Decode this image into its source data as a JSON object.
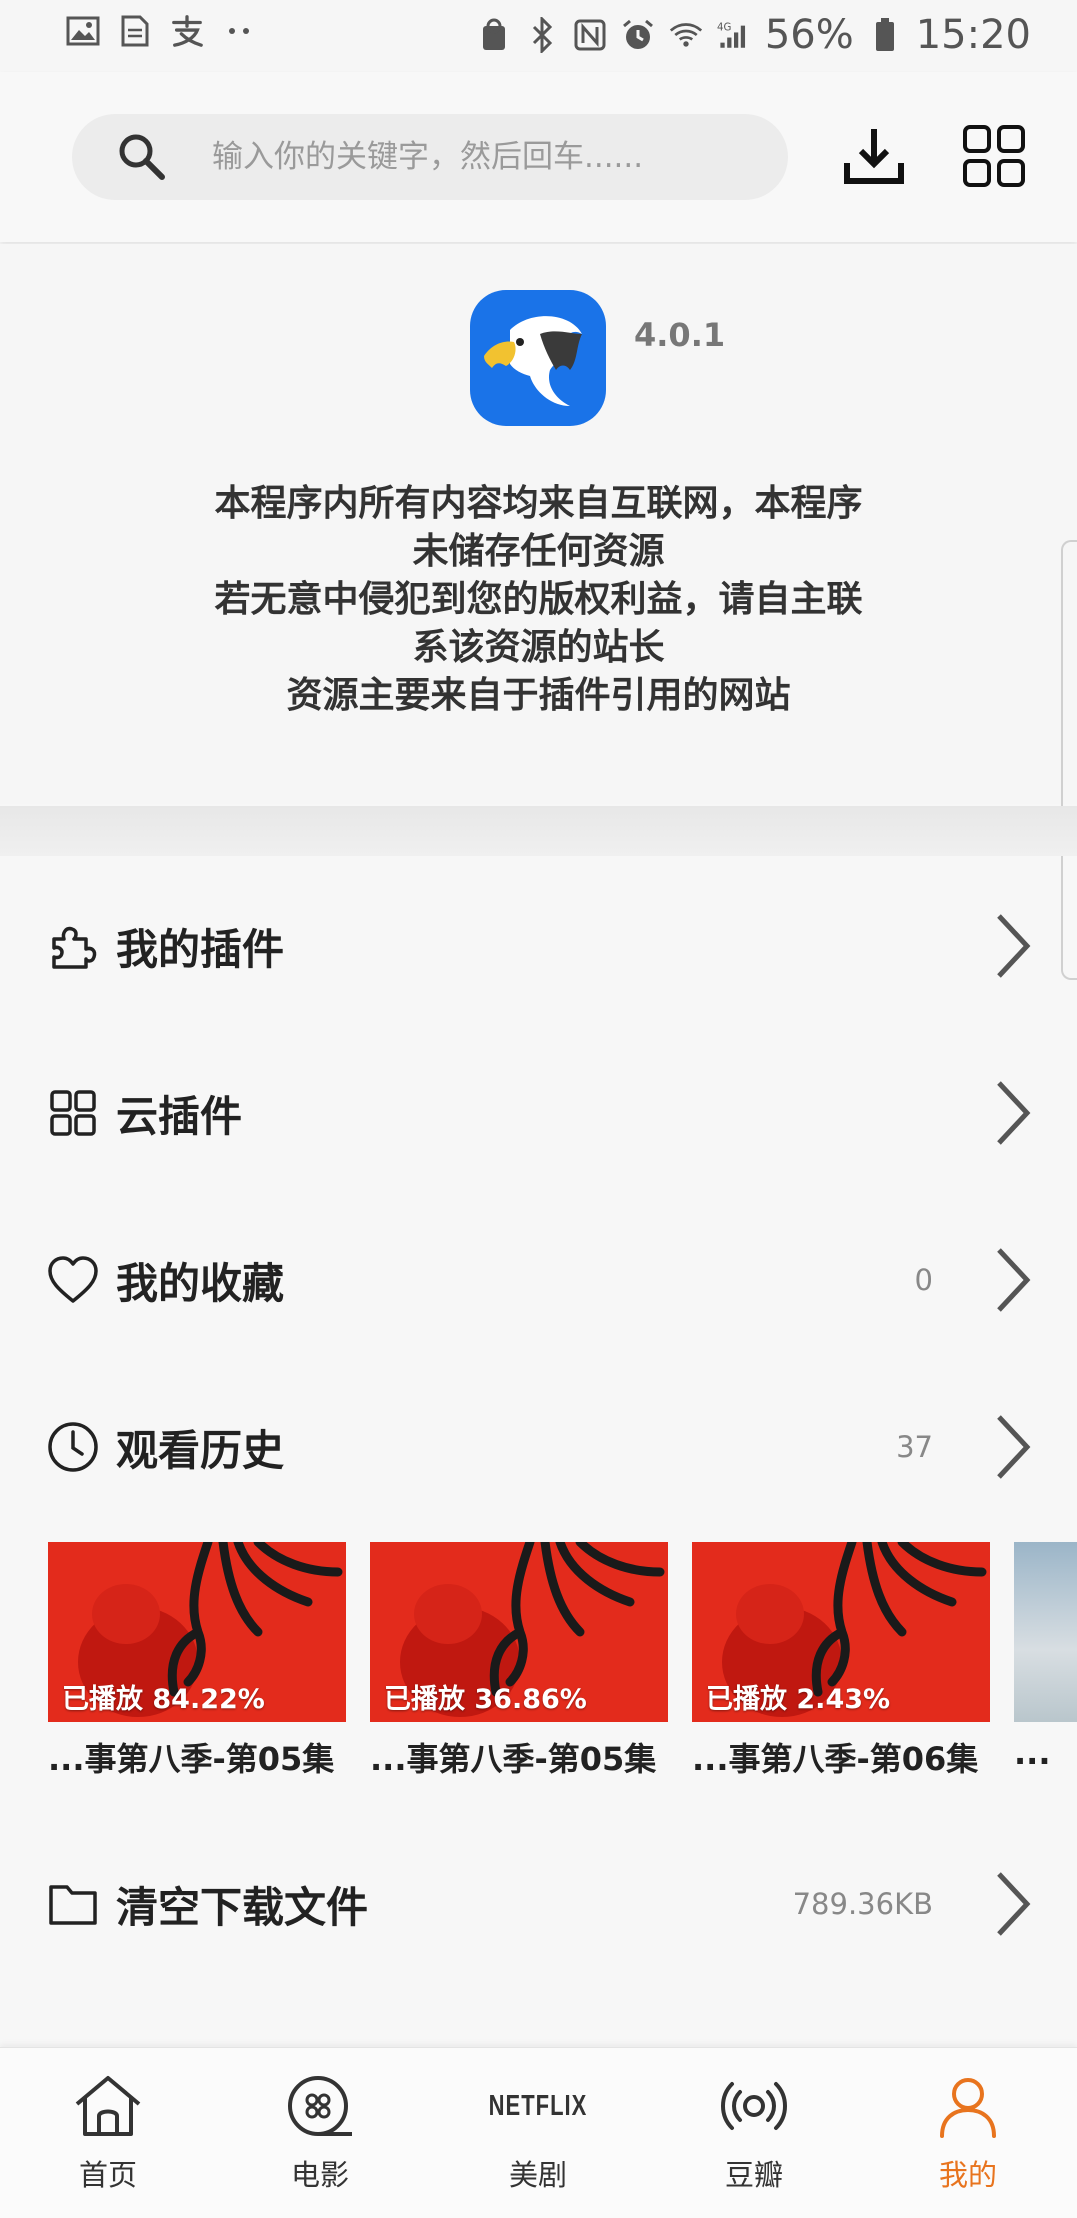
{
  "status_bar": {
    "battery": "56%",
    "time": "15:20",
    "network": "4G"
  },
  "header": {
    "search_placeholder": "输入你的关键字，然后回车......",
    "download_icon": "download-icon",
    "grid_icon": "grid-icon"
  },
  "about": {
    "version": "4.0.1",
    "disclaimer_lines": [
      "本程序内所有内容均来自互联网，本程序",
      "未储存任何资源",
      "若无意中侵犯到您的版权利益，请自主联",
      "系该资源的站长",
      "资源主要来自于插件引用的网站"
    ]
  },
  "menu": [
    {
      "label": "我的插件",
      "value": "",
      "icon": "puzzle-icon"
    },
    {
      "label": "云插件",
      "value": "",
      "icon": "grid-icon"
    },
    {
      "label": "我的收藏",
      "value": "0",
      "icon": "heart-icon"
    },
    {
      "label": "观看历史",
      "value": "37",
      "icon": "clock-icon"
    },
    {
      "label": "清空下载文件",
      "value": "789.36KB",
      "icon": "folder-icon"
    }
  ],
  "history": [
    {
      "progress": "已播放 84.22%",
      "title": "...事第八季-第05集"
    },
    {
      "progress": "已播放 36.86%",
      "title": "...事第八季-第05集"
    },
    {
      "progress": "已播放 2.43%",
      "title": "...事第八季-第06集"
    },
    {
      "progress": "",
      "title": "..."
    }
  ],
  "nav": [
    {
      "label": "首页",
      "icon": "home-icon",
      "active": false
    },
    {
      "label": "电影",
      "icon": "film-reel-icon",
      "active": false
    },
    {
      "label": "美剧",
      "icon": "netflix-icon",
      "icon_text": "NETFLIX",
      "active": false
    },
    {
      "label": "豆瓣",
      "icon": "broadcast-icon",
      "active": false
    },
    {
      "label": "我的",
      "icon": "person-icon",
      "active": true
    }
  ],
  "colors": {
    "accent": "#e8741e",
    "logo_bg": "#1a73e8",
    "thumb_red": "#e32b1c"
  }
}
